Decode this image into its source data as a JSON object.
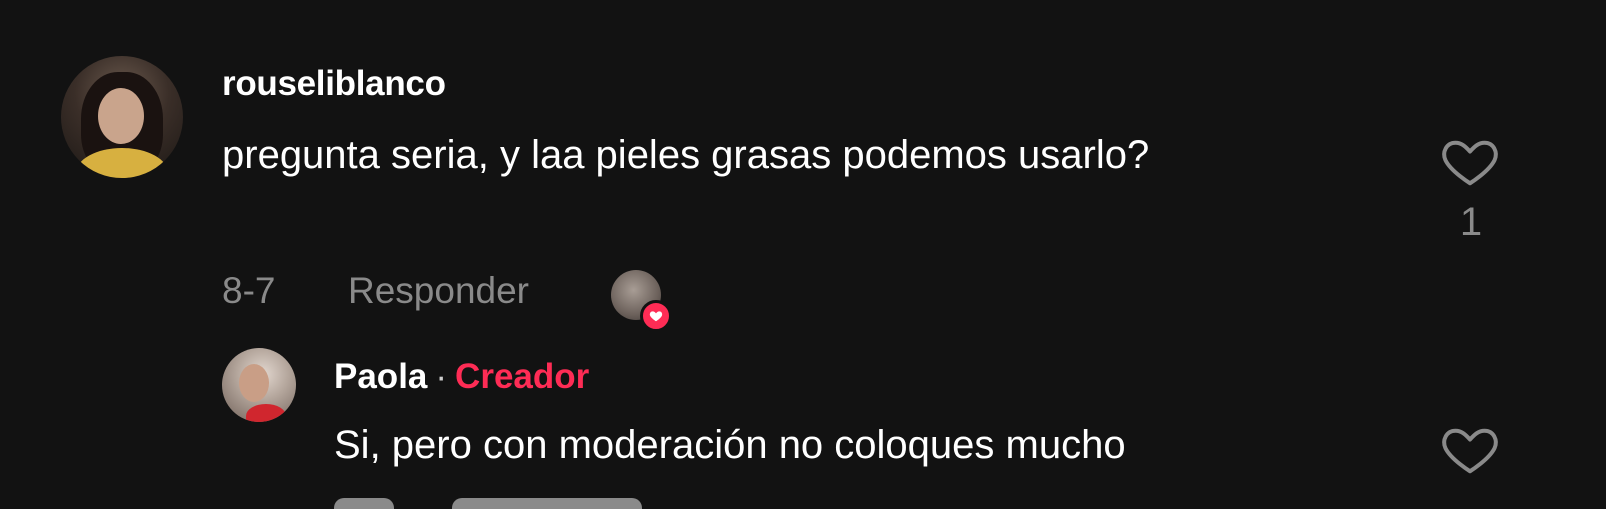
{
  "comment": {
    "username": "rouseliblanco",
    "text": "pregunta seria, y laa pieles grasas podemos usarlo?",
    "date": "8-7",
    "reply_label": "Responder",
    "like_count": "1",
    "avatar_icon": "user-avatar",
    "like_icon": "heart-outline-icon",
    "liked_by_creator_badge_color": "#fe2c55"
  },
  "reply": {
    "username": "Paola",
    "separator": "·",
    "creator_label": "Creador",
    "creator_color": "#fe2c55",
    "text": "Si, pero con moderación no coloques mucho",
    "like_icon": "heart-outline-icon"
  }
}
